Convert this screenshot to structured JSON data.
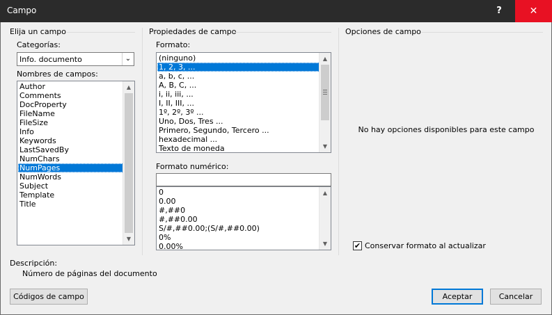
{
  "window": {
    "title": "Campo",
    "help_label": "?",
    "close_label": "✕"
  },
  "left": {
    "section_title": "Elija un campo",
    "categories_label": "Categorías:",
    "categories_value": "Info. documento",
    "field_names_label": "Nombres de campos:",
    "field_names": [
      "Author",
      "Comments",
      "DocProperty",
      "FileName",
      "FileSize",
      "Info",
      "Keywords",
      "LastSavedBy",
      "NumChars",
      "NumPages",
      "NumWords",
      "Subject",
      "Template",
      "Title"
    ],
    "selected_field": "NumPages"
  },
  "middle": {
    "section_title": "Propiedades de campo",
    "format_label": "Formato:",
    "formats": [
      "(ninguno)",
      "1, 2, 3, ...",
      "a, b, c, ...",
      "A, B, C, ...",
      "i, ii, iii, ...",
      "I, II, III, ...",
      "1º, 2º, 3º ...",
      "Uno, Dos, Tres ...",
      "Primero, Segundo, Tercero ...",
      "hexadecimal ...",
      "Texto de moneda"
    ],
    "selected_format": "1, 2, 3, ...",
    "numeric_format_label": "Formato numérico:",
    "numeric_format_value": "",
    "numeric_formats": [
      "0",
      "0.00",
      "#,##0",
      "#,##0.00",
      "S/#,##0.00;(S/#,##0.00)",
      "0%",
      "0.00%"
    ]
  },
  "right": {
    "section_title": "Opciones de campo",
    "no_options_text": "No hay opciones disponibles para este campo",
    "preserve_label": "Conservar formato al actualizar",
    "preserve_checked": true
  },
  "description": {
    "label": "Descripción:",
    "text": "Número de páginas del documento"
  },
  "buttons": {
    "field_codes": "Códigos de campo",
    "accept": "Aceptar",
    "cancel": "Cancelar"
  }
}
